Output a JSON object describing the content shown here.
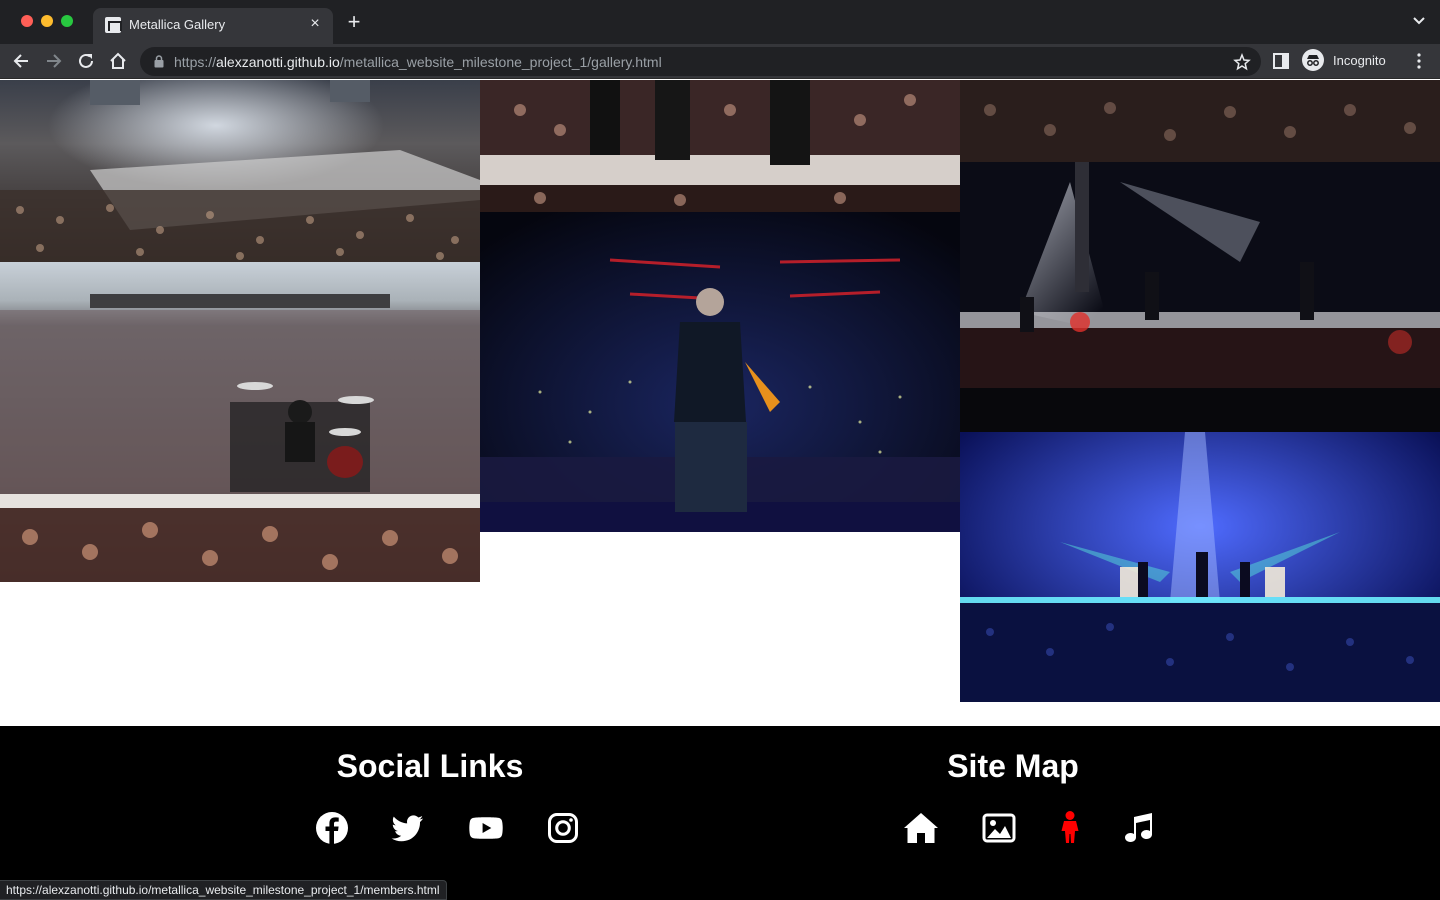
{
  "browser": {
    "tab_title": "Metallica Gallery",
    "url_prefix": "https://",
    "url_host": "alexzanotti.github.io",
    "url_path": "/metallica_website_milestone_project_1/gallery.html",
    "profile_label": "Incognito"
  },
  "gallery": {
    "photos": [
      {
        "icon": "concert-crowd-wide-photo"
      },
      {
        "icon": "stadium-drummer-photo"
      },
      {
        "icon": "stage-closeup-photo"
      },
      {
        "icon": "singer-back-guitar-photo"
      },
      {
        "icon": "crowd-hands-photo"
      },
      {
        "icon": "spotlight-stage-photo"
      },
      {
        "icon": "blue-stage-arena-photo"
      }
    ]
  },
  "footer": {
    "social_heading": "Social Links",
    "sitemap_heading": "Site Map",
    "social_icons": [
      "facebook-icon",
      "twitter-icon",
      "youtube-icon",
      "instagram-icon"
    ],
    "sitemap_icons": [
      "home-icon",
      "gallery-image-icon",
      "members-person-icon",
      "music-note-icon"
    ],
    "active_color": "#ff0000"
  },
  "status_bar": {
    "hover_url": "https://alexzanotti.github.io/metallica_website_milestone_project_1/members.html"
  }
}
